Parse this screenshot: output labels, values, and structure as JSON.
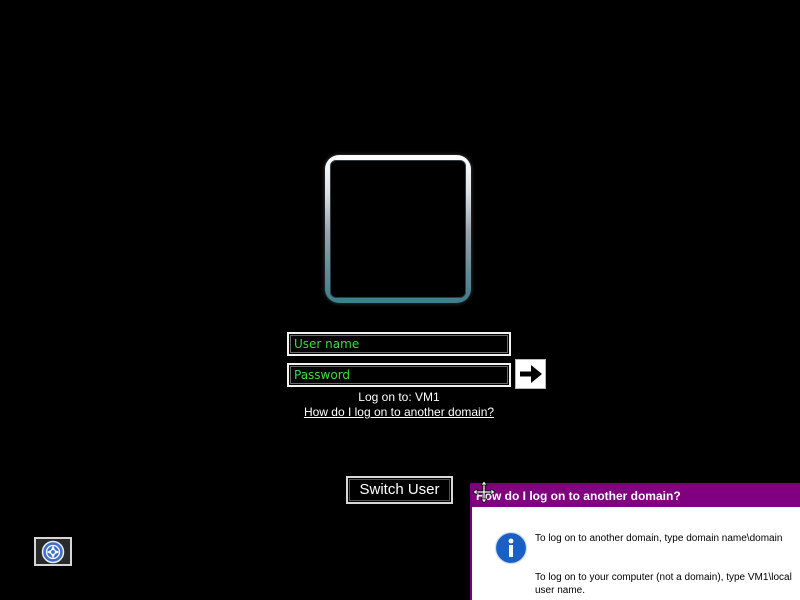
{
  "logon": {
    "username_placeholder": "User name",
    "password_placeholder": "Password",
    "logon_to": "Log on to: VM1",
    "other_domain_link": "How do I log on to another domain?"
  },
  "switch_user_label": "Switch User",
  "help_popup": {
    "title": "How do I log on to another domain?",
    "text_1": "To log on to another domain, type domain name\\domain",
    "text_2": "To log on to your computer (not a domain), type VM1\\local user name."
  },
  "icons": {
    "submit": "arrow-right-icon",
    "ease_of_access": "ease-of-access-icon",
    "info": "info-icon",
    "cursor": "move-cursor-icon"
  },
  "colors": {
    "background": "#000000",
    "placeholder_text": "#3cdc3c",
    "popup_title_bar": "#800080",
    "info_icon": "#1a5fc4"
  }
}
